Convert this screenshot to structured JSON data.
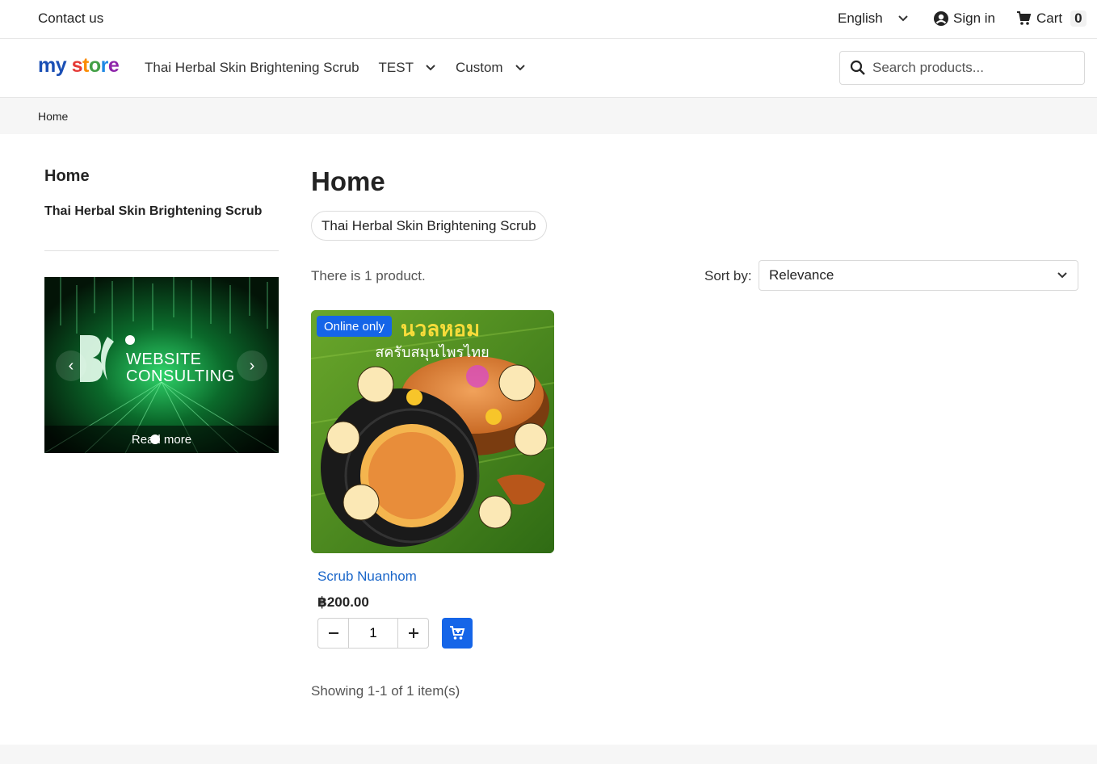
{
  "topbar": {
    "contact": "Contact us",
    "language": "English",
    "signin": "Sign in",
    "cart_label": "Cart",
    "cart_count": "0"
  },
  "header": {
    "logo": {
      "my": "my",
      "store": [
        "s",
        "t",
        "o",
        "r",
        "e"
      ]
    },
    "nav": [
      {
        "label": "Thai Herbal Skin Brightening Scrub"
      },
      {
        "label": "TEST"
      },
      {
        "label": "Custom"
      }
    ],
    "search_placeholder": "Search products..."
  },
  "breadcrumb": {
    "home": "Home"
  },
  "sidebar": {
    "title": "Home",
    "category": "Thai Herbal Skin Brightening Scrub",
    "slider": {
      "brand_line1": "WEBSITE",
      "brand_line2": "CONSULTING",
      "caption": "Read more"
    }
  },
  "main": {
    "title": "Home",
    "subcategory": "Thai Herbal Skin Brightening Scrub",
    "count_text": "There is 1 product.",
    "sort_label": "Sort by:",
    "sort_value": "Relevance",
    "showing_text": "Showing 1-1 of 1 item(s)"
  },
  "product": {
    "badge": "Online only",
    "name": "Scrub Nuanhom",
    "price": "฿200.00",
    "quantity": "1",
    "image_text_top": "นวลหอม",
    "image_text_sub": "สครับสมุนไพรไทย"
  },
  "colors": {
    "accent": "#1565e8",
    "link": "#1a66c9"
  }
}
